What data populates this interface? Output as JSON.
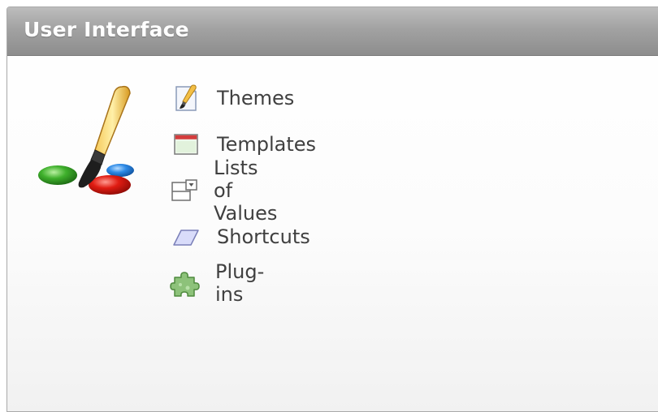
{
  "region": {
    "title": "User Interface",
    "main_icon": "paintbrush-palette-icon"
  },
  "links": [
    {
      "label": "Themes",
      "icon": "themes-icon"
    },
    {
      "label": "Templates",
      "icon": "templates-icon"
    },
    {
      "label": "Lists of Values",
      "icon": "lists-of-values-icon"
    },
    {
      "label": "Shortcuts",
      "icon": "shortcuts-icon"
    },
    {
      "label": "Plug-ins",
      "icon": "plug-ins-icon"
    }
  ],
  "colors": {
    "header": "#a2a2a2",
    "title_text": "#ffffff",
    "link_text": "#404040",
    "border": "#a9a9a9"
  }
}
